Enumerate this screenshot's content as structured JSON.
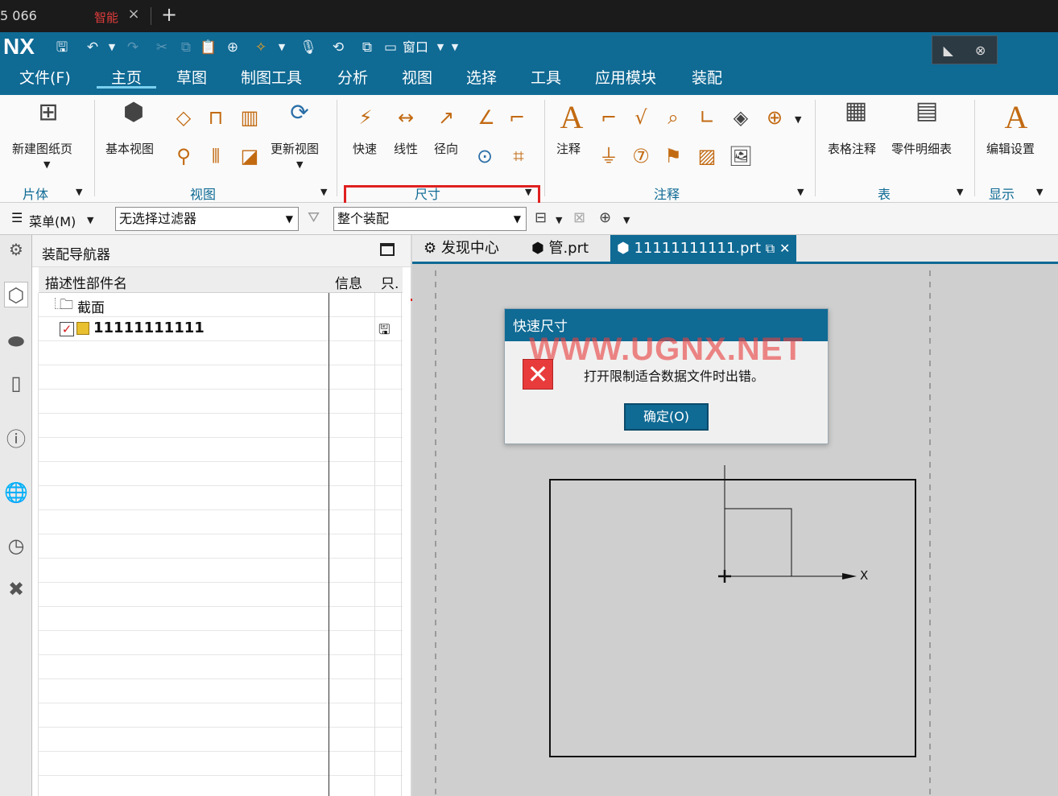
{
  "browser": {
    "tab1": "5 066",
    "tab2": "智能",
    "close": "×",
    "newtab": "+"
  },
  "app": {
    "logo": "NX",
    "quick_window": "窗口",
    "menu": [
      "文件(F)",
      "主页",
      "草图",
      "制图工具",
      "分析",
      "视图",
      "选择",
      "工具",
      "应用模块",
      "装配"
    ]
  },
  "ribbon": {
    "sheet": {
      "new_sheet": "新建图纸页",
      "group": "片体"
    },
    "view": {
      "base_view": "基本视图",
      "update_view": "更新视图",
      "group": "视图"
    },
    "dimension": {
      "rapid": "快速",
      "linear": "线性",
      "radial": "径向",
      "group": "尺寸"
    },
    "annotation": {
      "note": "注释",
      "group": "注释"
    },
    "table": {
      "tabular_note": "表格注释",
      "parts_list": "零件明细表",
      "group": "表"
    },
    "display": {
      "edit_settings": "编辑设置",
      "group": "显示"
    }
  },
  "selbar": {
    "menu": "菜单(M)",
    "filter": "无选择过滤器",
    "scope": "整个装配"
  },
  "navigator": {
    "title": "装配导航器",
    "col_name": "描述性部件名",
    "col_info": "信息",
    "col_ro": "只.",
    "rows": [
      {
        "name": "截面"
      },
      {
        "name": "11111111111"
      }
    ]
  },
  "graphics_tabs": [
    "发现中心",
    "管.prt",
    "11111111111.prt"
  ],
  "canvas": {
    "axis_x": "X"
  },
  "dialog": {
    "title": "快速尺寸",
    "watermark": "WWW.UGNX.NET",
    "message": "打开限制适合数据文件时出错。",
    "ok": "确定(O)"
  }
}
